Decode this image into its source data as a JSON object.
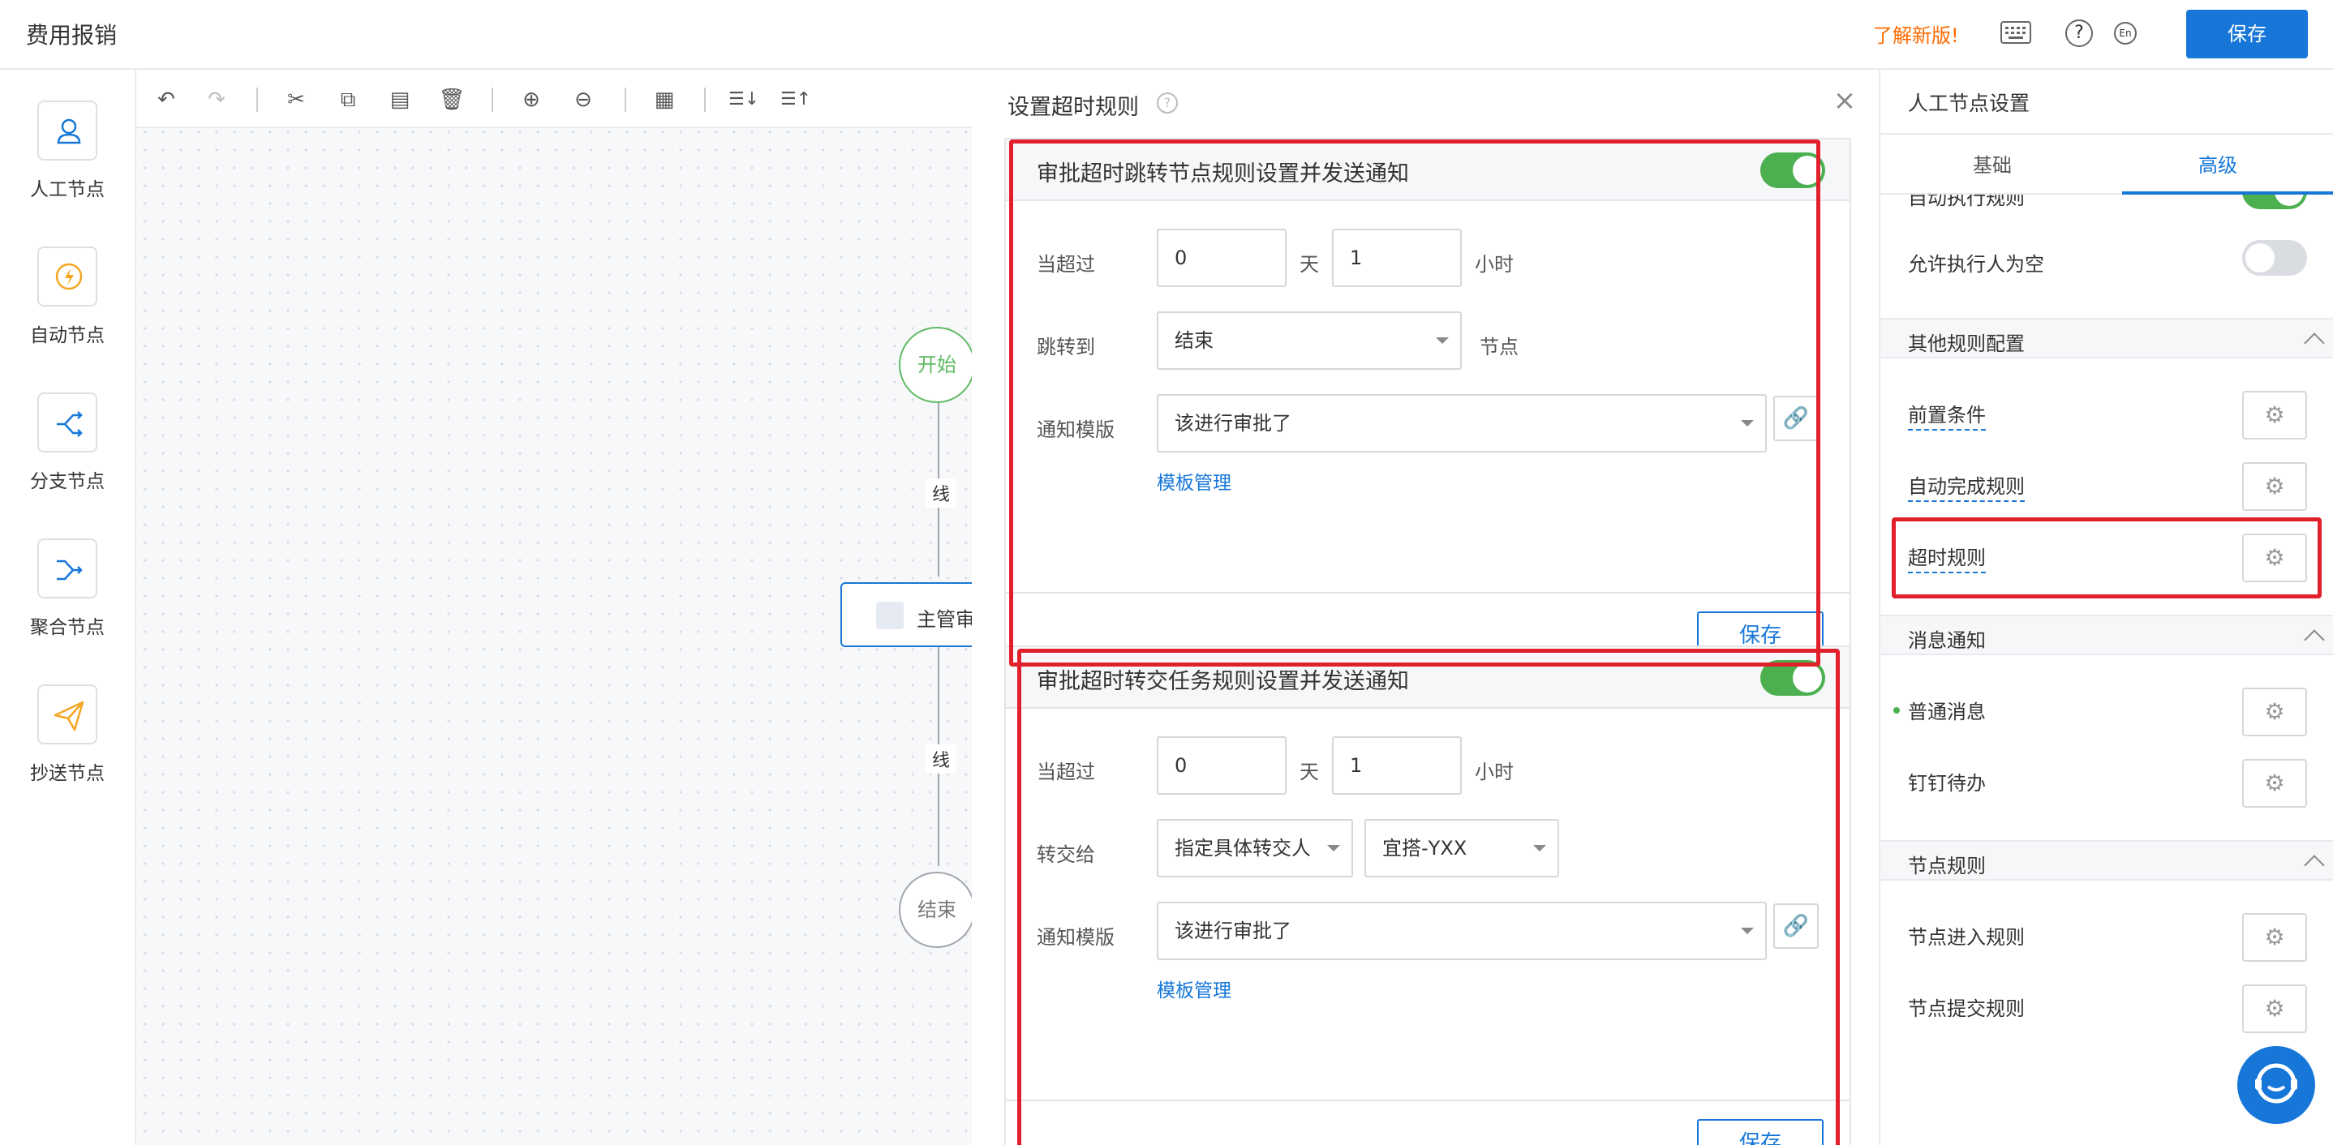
{
  "header": {
    "app_title": "费用报销",
    "new_version": "了解新版!",
    "lang": "En",
    "help": "?",
    "save": "保存"
  },
  "palette": {
    "items": [
      {
        "label": "人工节点",
        "icon": "user-icon"
      },
      {
        "label": "自动节点",
        "icon": "lightning-icon"
      },
      {
        "label": "分支节点",
        "icon": "branch-icon"
      },
      {
        "label": "聚合节点",
        "icon": "merge-icon"
      },
      {
        "label": "抄送节点",
        "icon": "send-icon"
      }
    ]
  },
  "canvas": {
    "start": "开始",
    "end": "结束",
    "approval": "主管审",
    "edge1": "线",
    "edge2": "线"
  },
  "modal": {
    "title": "设置超时规则",
    "card1": {
      "title": "审批超时跳转节点规则设置并发送通知",
      "enabled": true,
      "exceed_label": "当超过",
      "days": "0",
      "days_unit": "天",
      "hours": "1",
      "hours_unit": "小时",
      "jump_label": "跳转到",
      "jump_value": "结束",
      "jump_unit": "节点",
      "template_label": "通知模版",
      "template_value": "该进行审批了",
      "template_manage": "模板管理",
      "save": "保存"
    },
    "card2": {
      "title": "审批超时转交任务规则设置并发送通知",
      "enabled": true,
      "exceed_label": "当超过",
      "days": "0",
      "days_unit": "天",
      "hours": "1",
      "hours_unit": "小时",
      "transfer_label": "转交给",
      "transfer_type": "指定具体转交人",
      "transfer_person": "宜搭-YXX",
      "template_label": "通知模版",
      "template_value": "该进行审批了",
      "template_manage": "模板管理",
      "save": "保存"
    }
  },
  "right_panel": {
    "title": "人工节点设置",
    "tabs": [
      "基础",
      "高级"
    ],
    "active_tab": "高级",
    "partial_row": "自动执行规则",
    "allow_empty": "允许执行人为空",
    "sections": {
      "other_rules": "其他规则配置",
      "message": "消息通知",
      "node_rules": "节点规则"
    },
    "other_rules_items": [
      "前置条件",
      "自动完成规则",
      "超时规则"
    ],
    "message_items": [
      "普通消息",
      "钉钉待办"
    ],
    "node_rules_items": [
      "节点进入规则",
      "节点提交规则"
    ]
  },
  "colors": {
    "accent": "#1677d9",
    "toggle_on": "#4caf50",
    "highlight": "#e0202b",
    "new_version": "#ff6a00"
  }
}
